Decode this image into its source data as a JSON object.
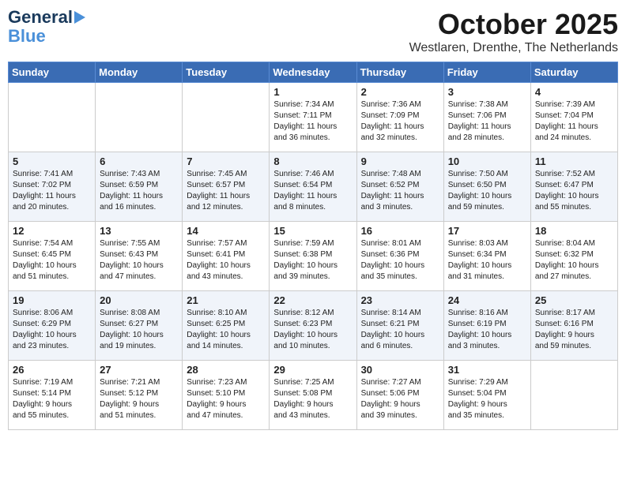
{
  "header": {
    "logo_line1": "General",
    "logo_line2": "Blue",
    "month": "October 2025",
    "location": "Westlaren, Drenthe, The Netherlands"
  },
  "days_of_week": [
    "Sunday",
    "Monday",
    "Tuesday",
    "Wednesday",
    "Thursday",
    "Friday",
    "Saturday"
  ],
  "weeks": [
    [
      {
        "day": "",
        "info": ""
      },
      {
        "day": "",
        "info": ""
      },
      {
        "day": "",
        "info": ""
      },
      {
        "day": "1",
        "info": "Sunrise: 7:34 AM\nSunset: 7:11 PM\nDaylight: 11 hours\nand 36 minutes."
      },
      {
        "day": "2",
        "info": "Sunrise: 7:36 AM\nSunset: 7:09 PM\nDaylight: 11 hours\nand 32 minutes."
      },
      {
        "day": "3",
        "info": "Sunrise: 7:38 AM\nSunset: 7:06 PM\nDaylight: 11 hours\nand 28 minutes."
      },
      {
        "day": "4",
        "info": "Sunrise: 7:39 AM\nSunset: 7:04 PM\nDaylight: 11 hours\nand 24 minutes."
      }
    ],
    [
      {
        "day": "5",
        "info": "Sunrise: 7:41 AM\nSunset: 7:02 PM\nDaylight: 11 hours\nand 20 minutes."
      },
      {
        "day": "6",
        "info": "Sunrise: 7:43 AM\nSunset: 6:59 PM\nDaylight: 11 hours\nand 16 minutes."
      },
      {
        "day": "7",
        "info": "Sunrise: 7:45 AM\nSunset: 6:57 PM\nDaylight: 11 hours\nand 12 minutes."
      },
      {
        "day": "8",
        "info": "Sunrise: 7:46 AM\nSunset: 6:54 PM\nDaylight: 11 hours\nand 8 minutes."
      },
      {
        "day": "9",
        "info": "Sunrise: 7:48 AM\nSunset: 6:52 PM\nDaylight: 11 hours\nand 3 minutes."
      },
      {
        "day": "10",
        "info": "Sunrise: 7:50 AM\nSunset: 6:50 PM\nDaylight: 10 hours\nand 59 minutes."
      },
      {
        "day": "11",
        "info": "Sunrise: 7:52 AM\nSunset: 6:47 PM\nDaylight: 10 hours\nand 55 minutes."
      }
    ],
    [
      {
        "day": "12",
        "info": "Sunrise: 7:54 AM\nSunset: 6:45 PM\nDaylight: 10 hours\nand 51 minutes."
      },
      {
        "day": "13",
        "info": "Sunrise: 7:55 AM\nSunset: 6:43 PM\nDaylight: 10 hours\nand 47 minutes."
      },
      {
        "day": "14",
        "info": "Sunrise: 7:57 AM\nSunset: 6:41 PM\nDaylight: 10 hours\nand 43 minutes."
      },
      {
        "day": "15",
        "info": "Sunrise: 7:59 AM\nSunset: 6:38 PM\nDaylight: 10 hours\nand 39 minutes."
      },
      {
        "day": "16",
        "info": "Sunrise: 8:01 AM\nSunset: 6:36 PM\nDaylight: 10 hours\nand 35 minutes."
      },
      {
        "day": "17",
        "info": "Sunrise: 8:03 AM\nSunset: 6:34 PM\nDaylight: 10 hours\nand 31 minutes."
      },
      {
        "day": "18",
        "info": "Sunrise: 8:04 AM\nSunset: 6:32 PM\nDaylight: 10 hours\nand 27 minutes."
      }
    ],
    [
      {
        "day": "19",
        "info": "Sunrise: 8:06 AM\nSunset: 6:29 PM\nDaylight: 10 hours\nand 23 minutes."
      },
      {
        "day": "20",
        "info": "Sunrise: 8:08 AM\nSunset: 6:27 PM\nDaylight: 10 hours\nand 19 minutes."
      },
      {
        "day": "21",
        "info": "Sunrise: 8:10 AM\nSunset: 6:25 PM\nDaylight: 10 hours\nand 14 minutes."
      },
      {
        "day": "22",
        "info": "Sunrise: 8:12 AM\nSunset: 6:23 PM\nDaylight: 10 hours\nand 10 minutes."
      },
      {
        "day": "23",
        "info": "Sunrise: 8:14 AM\nSunset: 6:21 PM\nDaylight: 10 hours\nand 6 minutes."
      },
      {
        "day": "24",
        "info": "Sunrise: 8:16 AM\nSunset: 6:19 PM\nDaylight: 10 hours\nand 3 minutes."
      },
      {
        "day": "25",
        "info": "Sunrise: 8:17 AM\nSunset: 6:16 PM\nDaylight: 9 hours\nand 59 minutes."
      }
    ],
    [
      {
        "day": "26",
        "info": "Sunrise: 7:19 AM\nSunset: 5:14 PM\nDaylight: 9 hours\nand 55 minutes."
      },
      {
        "day": "27",
        "info": "Sunrise: 7:21 AM\nSunset: 5:12 PM\nDaylight: 9 hours\nand 51 minutes."
      },
      {
        "day": "28",
        "info": "Sunrise: 7:23 AM\nSunset: 5:10 PM\nDaylight: 9 hours\nand 47 minutes."
      },
      {
        "day": "29",
        "info": "Sunrise: 7:25 AM\nSunset: 5:08 PM\nDaylight: 9 hours\nand 43 minutes."
      },
      {
        "day": "30",
        "info": "Sunrise: 7:27 AM\nSunset: 5:06 PM\nDaylight: 9 hours\nand 39 minutes."
      },
      {
        "day": "31",
        "info": "Sunrise: 7:29 AM\nSunset: 5:04 PM\nDaylight: 9 hours\nand 35 minutes."
      },
      {
        "day": "",
        "info": ""
      }
    ]
  ]
}
